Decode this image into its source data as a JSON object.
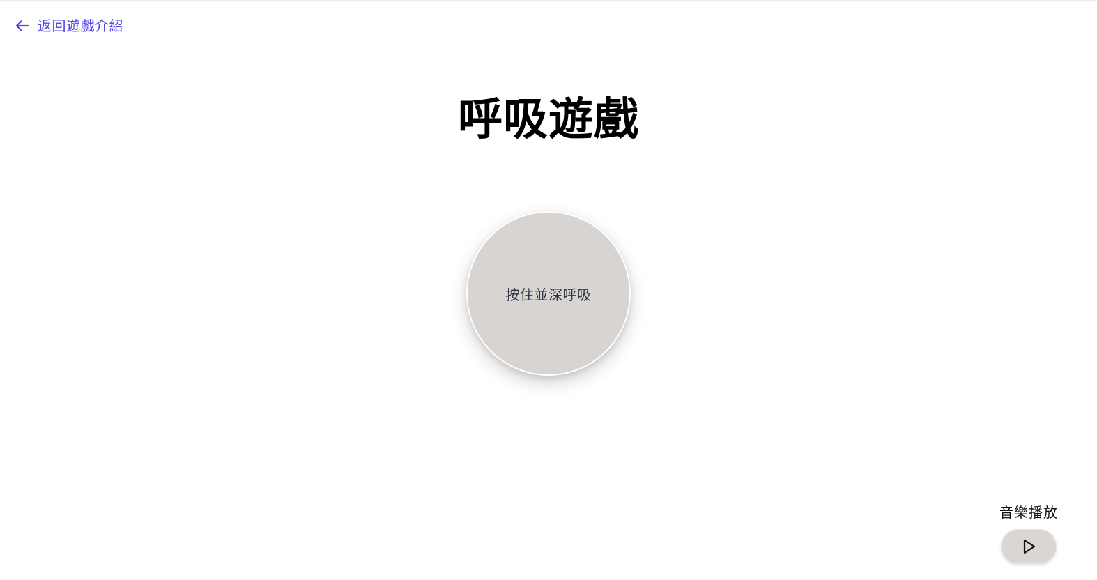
{
  "nav": {
    "back_label": "返回遊戲介紹",
    "back_icon": "arrow-left-icon"
  },
  "page": {
    "title": "呼吸遊戲"
  },
  "breath_button": {
    "label": "按住並深呼吸"
  },
  "music": {
    "label": "音樂播放",
    "play_icon": "play-icon"
  },
  "colors": {
    "accent": "#5046e4",
    "circle": "#d7d4d2",
    "button": "#d9d6d4",
    "title": "#000000",
    "circle_text": "#2f3445"
  }
}
